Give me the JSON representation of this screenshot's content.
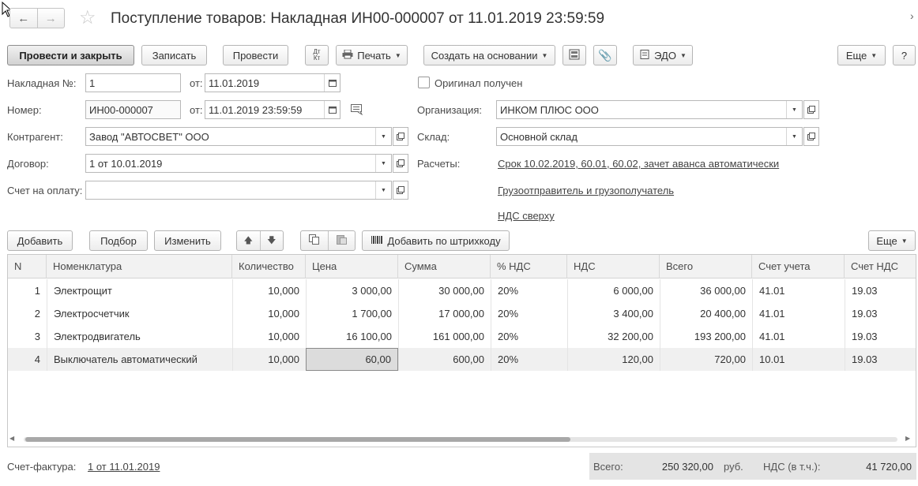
{
  "window": {
    "title": "Поступление товаров: Накладная ИН00-000007 от 11.01.2019 23:59:59"
  },
  "toolbar": {
    "post_close": "Провести и закрыть",
    "save": "Записать",
    "post": "Провести",
    "dt_kt": "Дт Кт",
    "print": "Печать",
    "create_based": "Создать на основании",
    "edo": "ЭДО",
    "more": "Еще",
    "help": "?"
  },
  "form": {
    "invoice_no_label": "Накладная №:",
    "invoice_no": "1",
    "from_label": "от:",
    "invoice_date": "11.01.2019",
    "number_label": "Номер:",
    "number": "ИН00-000007",
    "from_label2": "от:",
    "number_date": "11.01.2019 23:59:59",
    "original_label": "Оригинал получен",
    "org_label": "Организация:",
    "org": "ИНКОМ ПЛЮС ООО",
    "counterparty_label": "Контрагент:",
    "counterparty": "Завод \"АВТОСВЕТ\" ООО",
    "warehouse_label": "Склад:",
    "warehouse": "Основной склад",
    "contract_label": "Договор:",
    "contract": "1 от 10.01.2019",
    "settlements_label": "Расчеты:",
    "settlements_link": "Срок 10.02.2019, 60.01, 60.02, зачет аванса автоматически",
    "payment_label": "Счет на оплату:",
    "payment": "",
    "shipper_link": "Грузоотправитель и грузополучатель",
    "vat_link": "НДС сверху"
  },
  "table_toolbar": {
    "add": "Добавить",
    "select": "Подбор",
    "edit": "Изменить",
    "barcode": "Добавить по штрихкоду",
    "more": "Еще"
  },
  "table": {
    "columns": [
      "N",
      "Номенклатура",
      "Количество",
      "Цена",
      "Сумма",
      "% НДС",
      "НДС",
      "Всего",
      "Счет учета",
      "Счет НДС"
    ],
    "rows": [
      [
        "1",
        "Электрощит",
        "10,000",
        "3 000,00",
        "30 000,00",
        "20%",
        "6 000,00",
        "36 000,00",
        "41.01",
        "19.03"
      ],
      [
        "2",
        "Электросчетчик",
        "10,000",
        "1 700,00",
        "17 000,00",
        "20%",
        "3 400,00",
        "20 400,00",
        "41.01",
        "19.03"
      ],
      [
        "3",
        "Электродвигатель",
        "10,000",
        "16 100,00",
        "161 000,00",
        "20%",
        "32 200,00",
        "193 200,00",
        "41.01",
        "19.03"
      ],
      [
        "4",
        "Выключатель автоматический",
        "10,000",
        "60,00",
        "600,00",
        "20%",
        "120,00",
        "720,00",
        "10.01",
        "19.03"
      ]
    ]
  },
  "footer": {
    "invoice_label": "Счет-фактура:",
    "invoice_link": "1 от 11.01.2019",
    "total_label": "Всего:",
    "total": "250 320,00",
    "currency": "руб.",
    "vat_label": "НДС (в т.ч.):",
    "vat": "41 720,00"
  }
}
